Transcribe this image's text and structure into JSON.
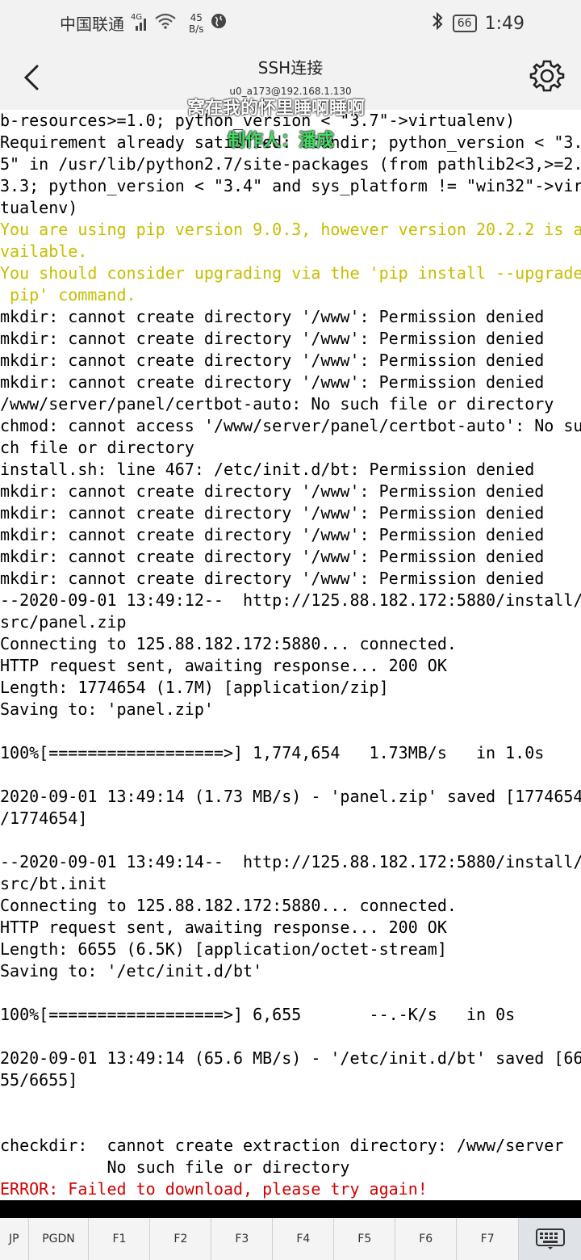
{
  "status_bar": {
    "carrier": "中国联通",
    "signal_label": "4G",
    "net_speed_value": "45",
    "net_speed_unit": "B/s",
    "battery": "66",
    "time": "1:49"
  },
  "app_bar": {
    "title": "SSH连接",
    "subtitle": "u0_a173@192.168.1.130"
  },
  "overlay": {
    "caption": "窝在我的怀里睡啊睡啊",
    "author": "制作人：潘成"
  },
  "terminal": {
    "lines": [
      {
        "text": "b-resources>=1.0; python_version < \"3.7\"->virtualenv)",
        "style": "normal"
      },
      {
        "text": "Requirement already satisfied: scandir; python_version < \"3.",
        "style": "normal"
      },
      {
        "text": "5\" in /usr/lib/python2.7/site-packages (from pathlib2<3,>=2.",
        "style": "normal"
      },
      {
        "text": "3.3; python_version < \"3.4\" and sys_platform != \"win32\"->vir",
        "style": "normal"
      },
      {
        "text": "tualenv)",
        "style": "normal"
      },
      {
        "text": "You are using pip version 9.0.3, however version 20.2.2 is a",
        "style": "yellow"
      },
      {
        "text": "vailable.",
        "style": "yellow"
      },
      {
        "text": "You should consider upgrading via the 'pip install --upgrade",
        "style": "yellow"
      },
      {
        "text": " pip' command.",
        "style": "yellow"
      },
      {
        "text": "mkdir: cannot create directory '/www': Permission denied",
        "style": "normal"
      },
      {
        "text": "mkdir: cannot create directory '/www': Permission denied",
        "style": "normal"
      },
      {
        "text": "mkdir: cannot create directory '/www': Permission denied",
        "style": "normal"
      },
      {
        "text": "mkdir: cannot create directory '/www': Permission denied",
        "style": "normal"
      },
      {
        "text": "/www/server/panel/certbot-auto: No such file or directory",
        "style": "normal"
      },
      {
        "text": "chmod: cannot access '/www/server/panel/certbot-auto': No su",
        "style": "normal"
      },
      {
        "text": "ch file or directory",
        "style": "normal"
      },
      {
        "text": "install.sh: line 467: /etc/init.d/bt: Permission denied",
        "style": "normal"
      },
      {
        "text": "mkdir: cannot create directory '/www': Permission denied",
        "style": "normal"
      },
      {
        "text": "mkdir: cannot create directory '/www': Permission denied",
        "style": "normal"
      },
      {
        "text": "mkdir: cannot create directory '/www': Permission denied",
        "style": "normal"
      },
      {
        "text": "mkdir: cannot create directory '/www': Permission denied",
        "style": "normal"
      },
      {
        "text": "mkdir: cannot create directory '/www': Permission denied",
        "style": "normal"
      },
      {
        "text": "--2020-09-01 13:49:12--  http://125.88.182.172:5880/install/",
        "style": "normal"
      },
      {
        "text": "src/panel.zip",
        "style": "normal"
      },
      {
        "text": "Connecting to 125.88.182.172:5880... connected.",
        "style": "normal"
      },
      {
        "text": "HTTP request sent, awaiting response... 200 OK",
        "style": "normal"
      },
      {
        "text": "Length: 1774654 (1.7M) [application/zip]",
        "style": "normal"
      },
      {
        "text": "Saving to: 'panel.zip'",
        "style": "normal"
      },
      {
        "text": "",
        "style": "normal"
      },
      {
        "text": "100%[==================>] 1,774,654   1.73MB/s   in 1.0s",
        "style": "normal"
      },
      {
        "text": "",
        "style": "normal"
      },
      {
        "text": "2020-09-01 13:49:14 (1.73 MB/s) - 'panel.zip' saved [1774654",
        "style": "normal"
      },
      {
        "text": "/1774654]",
        "style": "normal"
      },
      {
        "text": "",
        "style": "normal"
      },
      {
        "text": "--2020-09-01 13:49:14--  http://125.88.182.172:5880/install/",
        "style": "normal"
      },
      {
        "text": "src/bt.init",
        "style": "normal"
      },
      {
        "text": "Connecting to 125.88.182.172:5880... connected.",
        "style": "normal"
      },
      {
        "text": "HTTP request sent, awaiting response... 200 OK",
        "style": "normal"
      },
      {
        "text": "Length: 6655 (6.5K) [application/octet-stream]",
        "style": "normal"
      },
      {
        "text": "Saving to: '/etc/init.d/bt'",
        "style": "normal"
      },
      {
        "text": "",
        "style": "normal"
      },
      {
        "text": "100%[==================>] 6,655       --.-K/s   in 0s",
        "style": "normal"
      },
      {
        "text": "",
        "style": "normal"
      },
      {
        "text": "2020-09-01 13:49:14 (65.6 MB/s) - '/etc/init.d/bt' saved [66",
        "style": "normal"
      },
      {
        "text": "55/6655]",
        "style": "normal"
      },
      {
        "text": "",
        "style": "normal"
      },
      {
        "text": "",
        "style": "normal"
      },
      {
        "text": "checkdir:  cannot create extraction directory: /www/server",
        "style": "normal"
      },
      {
        "text": "           No such file or directory",
        "style": "normal"
      },
      {
        "text": "ERROR: Failed to download, please try again!",
        "style": "red"
      },
      {
        "text": "============================================",
        "style": "normal"
      }
    ]
  },
  "key_bar": {
    "keys": [
      "JP",
      "PGDN",
      "F1",
      "F2",
      "F3",
      "F4",
      "F5",
      "F6",
      "F7"
    ]
  },
  "colors": {
    "warning": "#c8bd00",
    "error": "#d40000",
    "overlay_author": "#44dd66"
  }
}
